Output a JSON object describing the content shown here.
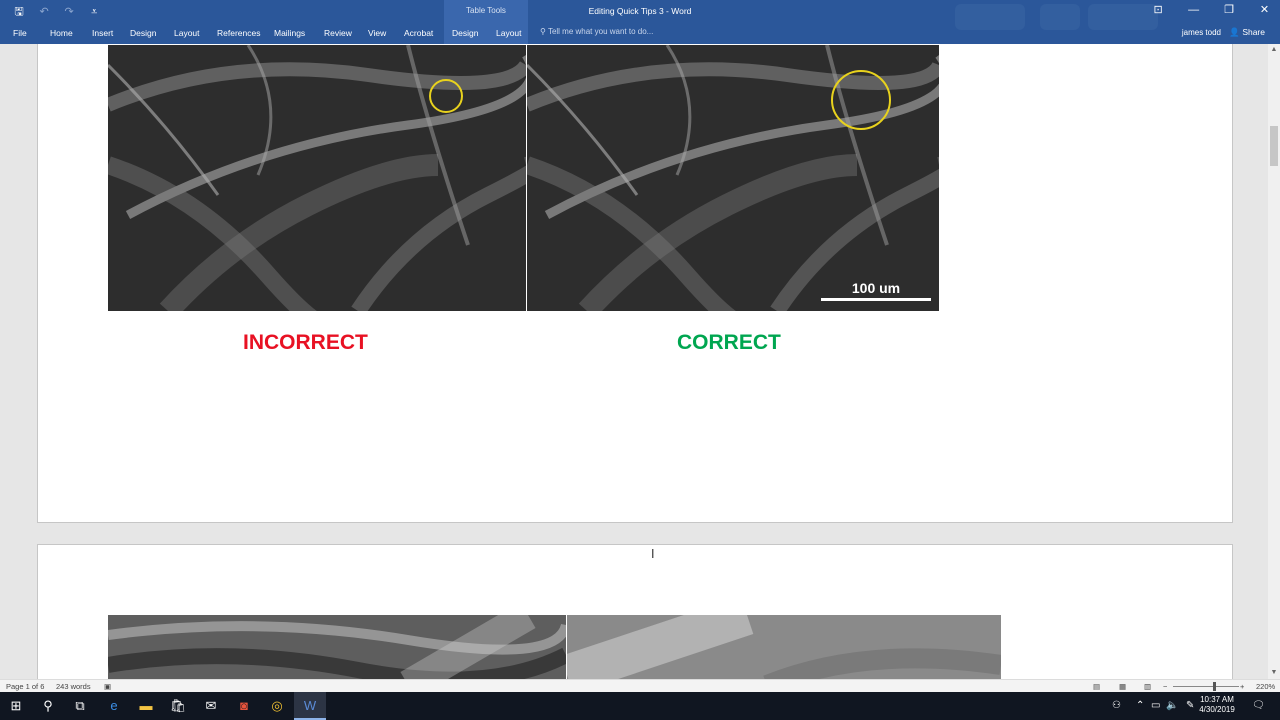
{
  "titlebar": {
    "doc_title": "Editing Quick Tips 3 - Word",
    "context_group": "Table Tools",
    "qat": {
      "save": "🖫",
      "undo": "↶",
      "redo": "↷",
      "customize": "⩡"
    },
    "window_controls": {
      "ribbon_display": "⊡",
      "minimize": "—",
      "restore": "❐",
      "close": "✕"
    }
  },
  "menu": {
    "file": "File",
    "home": "Home",
    "insert": "Insert",
    "design": "Design",
    "layout": "Layout",
    "references": "References",
    "mailings": "Mailings",
    "review": "Review",
    "view": "View",
    "acrobat": "Acrobat",
    "table_design": "Design",
    "table_layout": "Layout",
    "tell_me": "Tell me what you want to do...",
    "user": "james todd",
    "share": "Share"
  },
  "document": {
    "label_incorrect": "INCORRECT",
    "label_correct": "CORRECT",
    "scale_bar": "100 um"
  },
  "status": {
    "page": "Page 1 of 6",
    "words": "243 words",
    "zoom": "220%"
  },
  "taskbar": {
    "time": "10:37 AM",
    "date": "4/30/2019"
  },
  "colors": {
    "accent": "#2b579a",
    "incorrect": "#e81123",
    "correct": "#00a650",
    "highlight_circle": "#e8d21d"
  }
}
